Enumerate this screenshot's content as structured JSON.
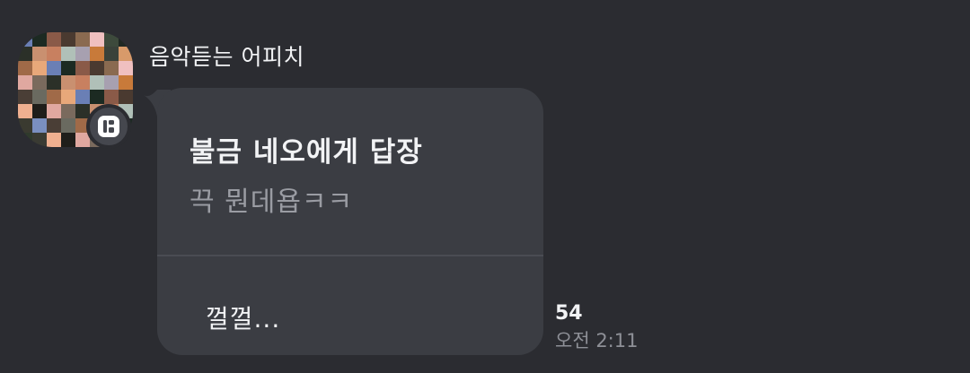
{
  "sender": {
    "name": "음악듣는 어피치"
  },
  "message": {
    "reply_header": "불금 네오에게 답장",
    "quoted_text": "끅 뭔데욥ㅋㅋ",
    "body": "껄껄...",
    "unread_count": "54",
    "time": "오전 2:11"
  },
  "colors": {
    "background": "#2b2c31",
    "bubble": "#3b3d43",
    "text_primary": "#f2f3f5",
    "text_muted": "#9a9ca3",
    "divider": "#4a4c53"
  },
  "icons": {
    "app_badge": "app-badge-icon"
  }
}
